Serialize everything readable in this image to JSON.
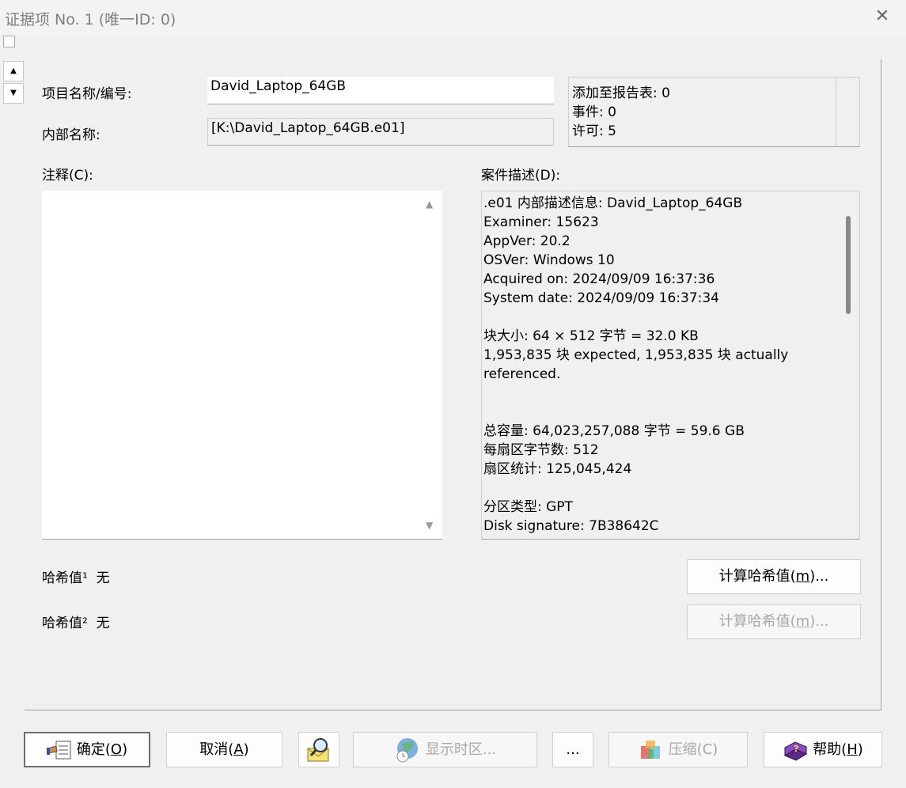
{
  "window": {
    "title": "证据项 No. 1 (唯一ID: 0)",
    "close_glyph": "✕"
  },
  "labels": {
    "item_name": "项目名称/编号:",
    "internal_name": "内部名称:",
    "comment": "注释(C):",
    "case_desc": "案件描述(D):",
    "hash1": "哈希值¹",
    "hash2": "哈希值²"
  },
  "fields": {
    "item_name_value": "David_Laptop_64GB",
    "internal_name_value": "[K:\\David_Laptop_64GB.e01]",
    "comment_value": "",
    "hash1_value": "无",
    "hash2_value": "无"
  },
  "stats": {
    "added_to_report": "添加至报告表: 0",
    "events": "事件: 0",
    "permission": " 许可: 5"
  },
  "description_lines": [
    ".e01 内部描述信息: David_Laptop_64GB",
    "Examiner: 15623",
    "AppVer: 20.2",
    "OSVer: Windows 10",
    "Acquired on: 2024/09/09  16:37:36",
    "System date: 2024/09/09  16:37:34",
    "",
    "块大小: 64 × 512 字节 = 32.0 KB",
    "1,953,835 块 expected, 1,953,835 块 actually",
    "referenced.",
    "",
    "",
    "总容量: 64,023,257,088 字节 = 59.6 GB",
    "每扇区字节数: 512",
    "扇区统计: 125,045,424",
    "",
    "分区类型: GPT",
    "Disk signature: 7B38642C"
  ],
  "buttons": {
    "compute_hash1": {
      "pre": "计算哈希值(",
      "key": "m",
      "post": ")..."
    },
    "compute_hash2": {
      "pre": "计算哈希值(",
      "key": "m",
      "post": ")..."
    },
    "ok": {
      "pre": "确定(",
      "key": "O",
      "post": ")"
    },
    "cancel": {
      "pre": "取消(",
      "key": "A",
      "post": ")"
    },
    "timezone": "显示时区...",
    "more": "...",
    "compress": "压缩(C)",
    "help": {
      "pre": "帮助(",
      "key": "H",
      "post": ")"
    }
  },
  "icons": {
    "ok": "hand-form-icon",
    "search": "magnifier-icon",
    "timezone": "globe-clock-icon",
    "compress": "archive-icon",
    "help": "help-book-icon",
    "spin_up": "▲",
    "spin_down": "▼"
  }
}
